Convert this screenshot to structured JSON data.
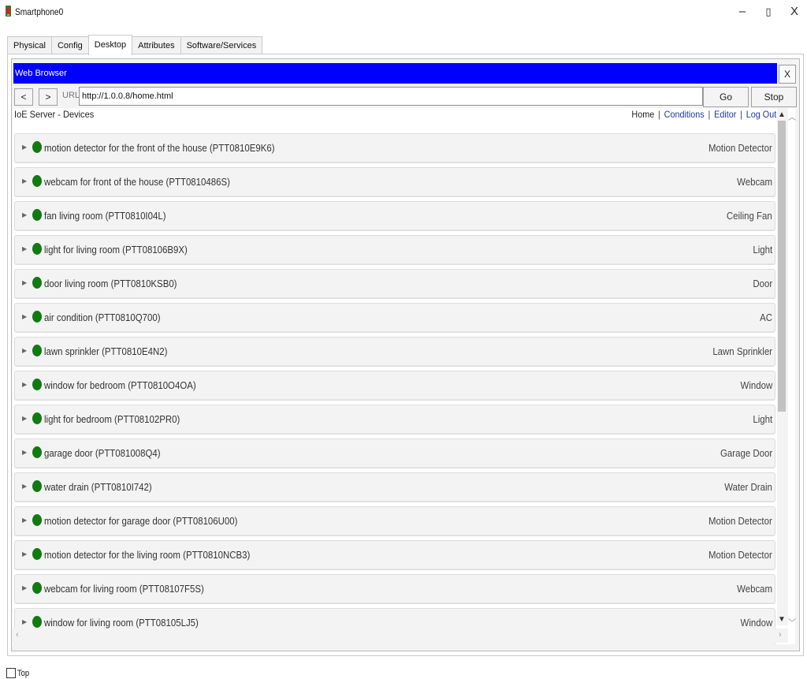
{
  "window": {
    "title": "Smartphone0",
    "icon": "pt-device-icon",
    "controls": {
      "minimize": "–",
      "maximize": "▯",
      "close": "X"
    }
  },
  "tabs": [
    {
      "label": "Physical",
      "active": false
    },
    {
      "label": "Config",
      "active": false
    },
    {
      "label": "Desktop",
      "active": true
    },
    {
      "label": "Attributes",
      "active": false
    },
    {
      "label": "Software/Services",
      "active": false
    }
  ],
  "browser": {
    "title": "Web Browser",
    "close_label": "X",
    "back_label": "<",
    "forward_label": ">",
    "url_label": "URL",
    "url_value": "http://1.0.0.8/home.html",
    "go_label": "Go",
    "stop_label": "Stop",
    "titlebar_color": "#0000ff"
  },
  "page": {
    "title": "IoE Server - Devices",
    "nav": {
      "home": "Home",
      "conditions": "Conditions",
      "editor": "Editor",
      "logout": "Log Out",
      "separator": "|"
    }
  },
  "devices": [
    {
      "name": "motion detector for the front of the house (PTT0810E9K6)",
      "type": "Motion Detector"
    },
    {
      "name": "webcam for front of the house (PTT0810486S)",
      "type": "Webcam"
    },
    {
      "name": "fan living room (PTT0810I04L)",
      "type": "Ceiling Fan"
    },
    {
      "name": "light for living room (PTT08106B9X)",
      "type": "Light"
    },
    {
      "name": "door living room (PTT0810KSB0)",
      "type": "Door"
    },
    {
      "name": "air condition (PTT0810Q700)",
      "type": "AC"
    },
    {
      "name": "lawn sprinkler (PTT0810E4N2)",
      "type": "Lawn Sprinkler"
    },
    {
      "name": "window for bedroom (PTT0810O4OA)",
      "type": "Window"
    },
    {
      "name": "light for bedroom (PTT08102PR0)",
      "type": "Light"
    },
    {
      "name": "garage door (PTT081008Q4)",
      "type": "Garage Door"
    },
    {
      "name": "water drain (PTT0810I742)",
      "type": "Water Drain"
    },
    {
      "name": "motion detector for garage door (PTT08106U00)",
      "type": "Motion Detector"
    },
    {
      "name": "motion detector for the living room (PTT0810NCB3)",
      "type": "Motion Detector"
    },
    {
      "name": "webcam for living room (PTT08107F5S)",
      "type": "Webcam"
    },
    {
      "name": "window for living room (PTT08105LJ5)",
      "type": "Window"
    }
  ],
  "status_color": "#117a11",
  "footer": {
    "top_label": "Top",
    "top_checked": false
  }
}
